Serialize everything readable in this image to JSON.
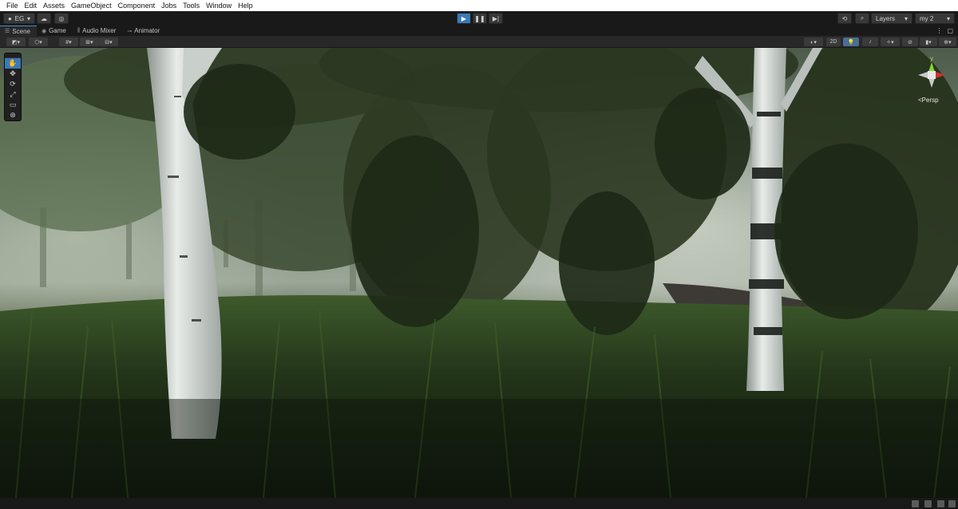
{
  "menu": [
    "File",
    "Edit",
    "Assets",
    "GameObject",
    "Component",
    "Jobs",
    "Tools",
    "Window",
    "Help"
  ],
  "toolbar": {
    "account_label": "EG",
    "layers_label": "Layers",
    "layout_label": "my 2"
  },
  "tabs": [
    "Scene",
    "Game",
    "Audio Mixer",
    "Animator"
  ],
  "scene_toolbar": {
    "mode_2d_label": "2D"
  },
  "gizmo": {
    "axis_y": "y",
    "projection": "Persp"
  }
}
